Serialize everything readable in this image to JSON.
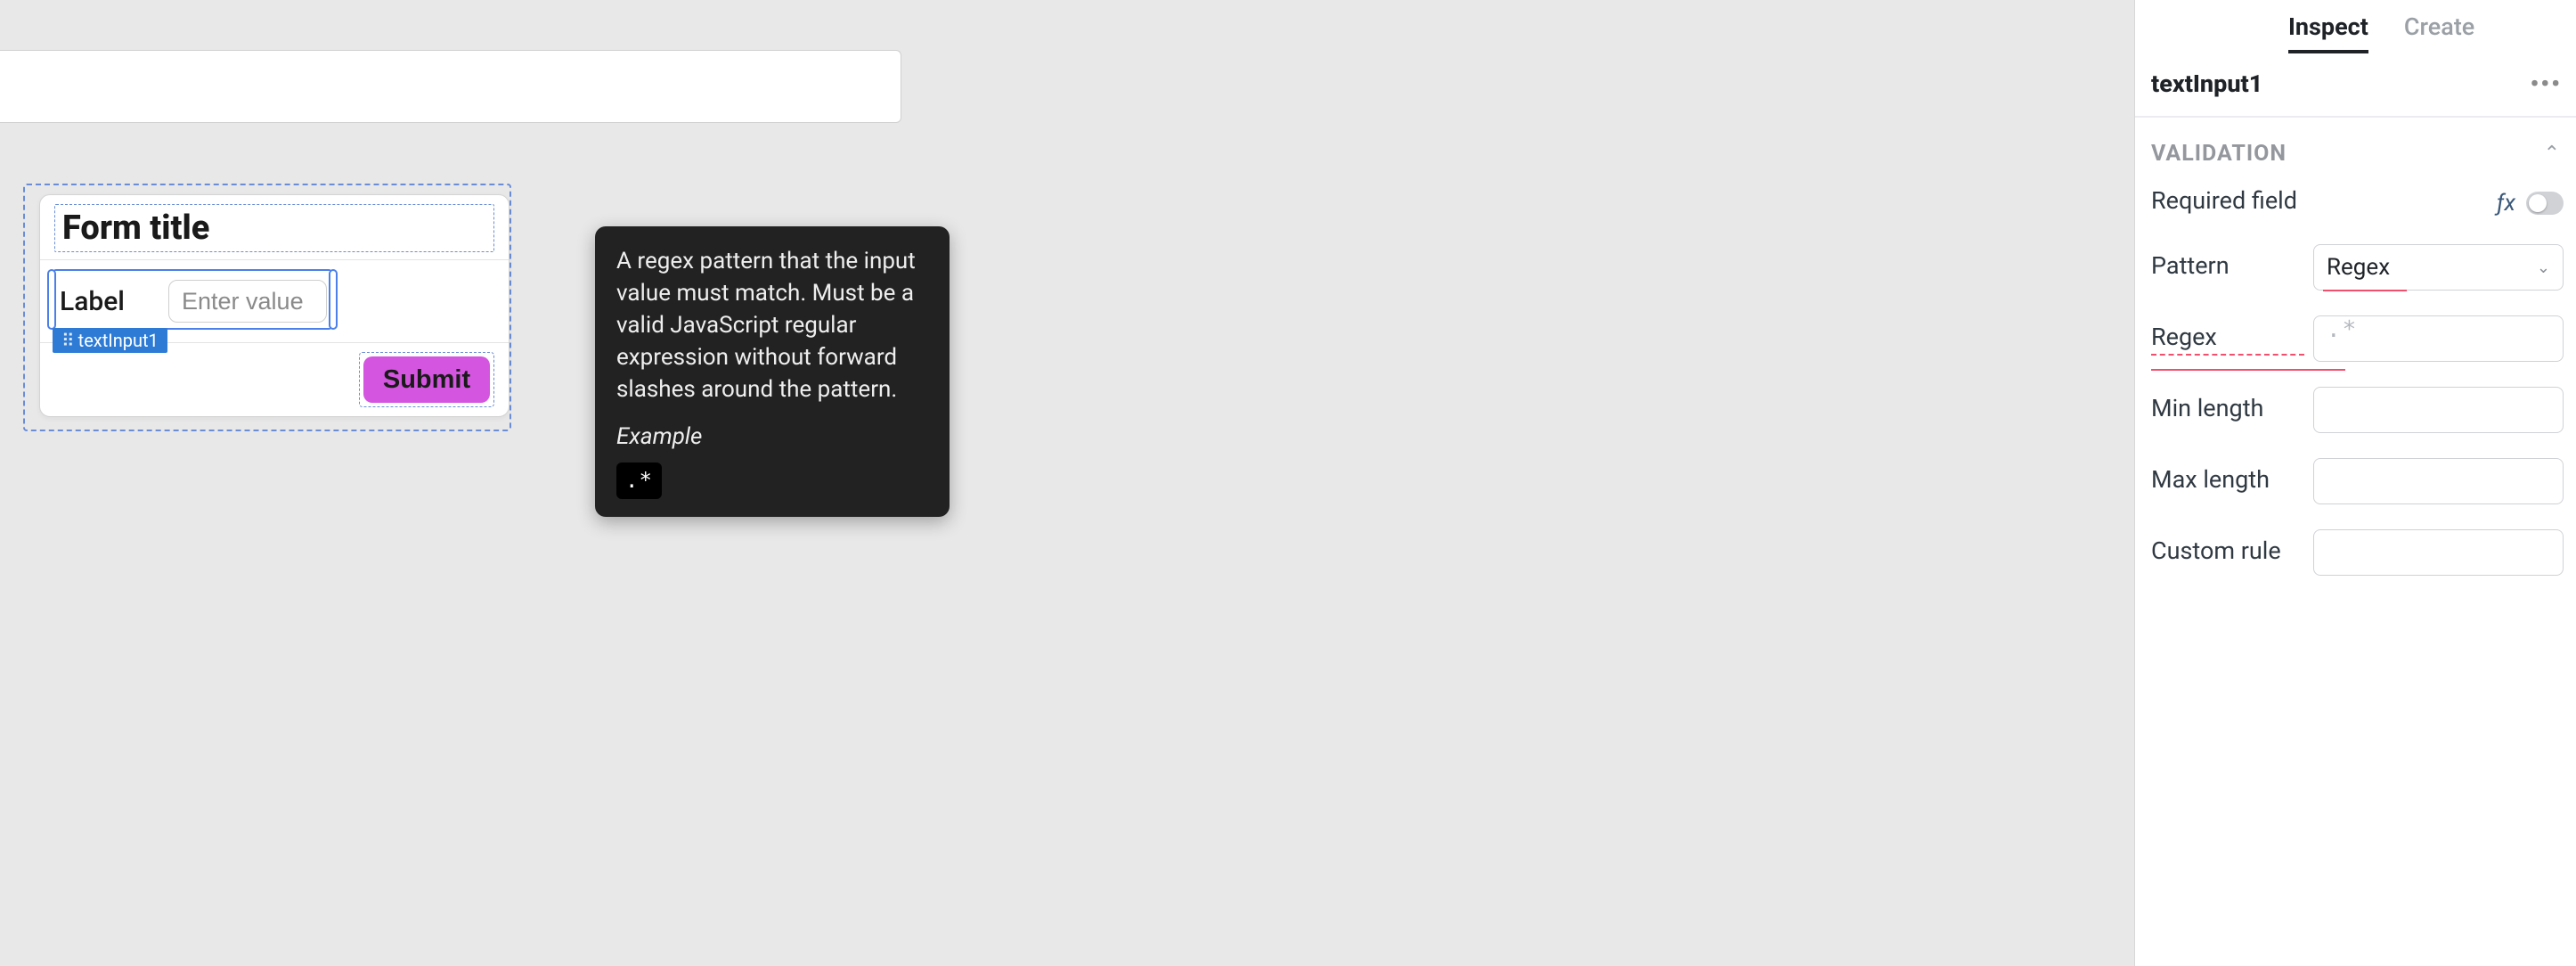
{
  "canvas": {
    "form": {
      "title": "Form title",
      "input": {
        "label": "Label",
        "placeholder": "Enter value",
        "component_tag": "textInput1"
      },
      "submit_label": "Submit"
    }
  },
  "tooltip": {
    "body": "A regex pattern that the input value must match. Must be a valid JavaScript regular expression without forward slashes around the pattern.",
    "example_label": "Example",
    "example_value": ".*"
  },
  "inspector": {
    "tabs": {
      "inspect": "Inspect",
      "create": "Create",
      "active": "inspect"
    },
    "component_name": "textInput1",
    "section_title": "VALIDATION",
    "required_label": "Required field",
    "fx_label": "ƒx",
    "required_on": false,
    "pattern_label": "Pattern",
    "pattern_value": "Regex",
    "regex_label": "Regex",
    "regex_placeholder": ".*",
    "min_length_label": "Min length",
    "max_length_label": "Max length",
    "custom_rule_label": "Custom rule"
  }
}
